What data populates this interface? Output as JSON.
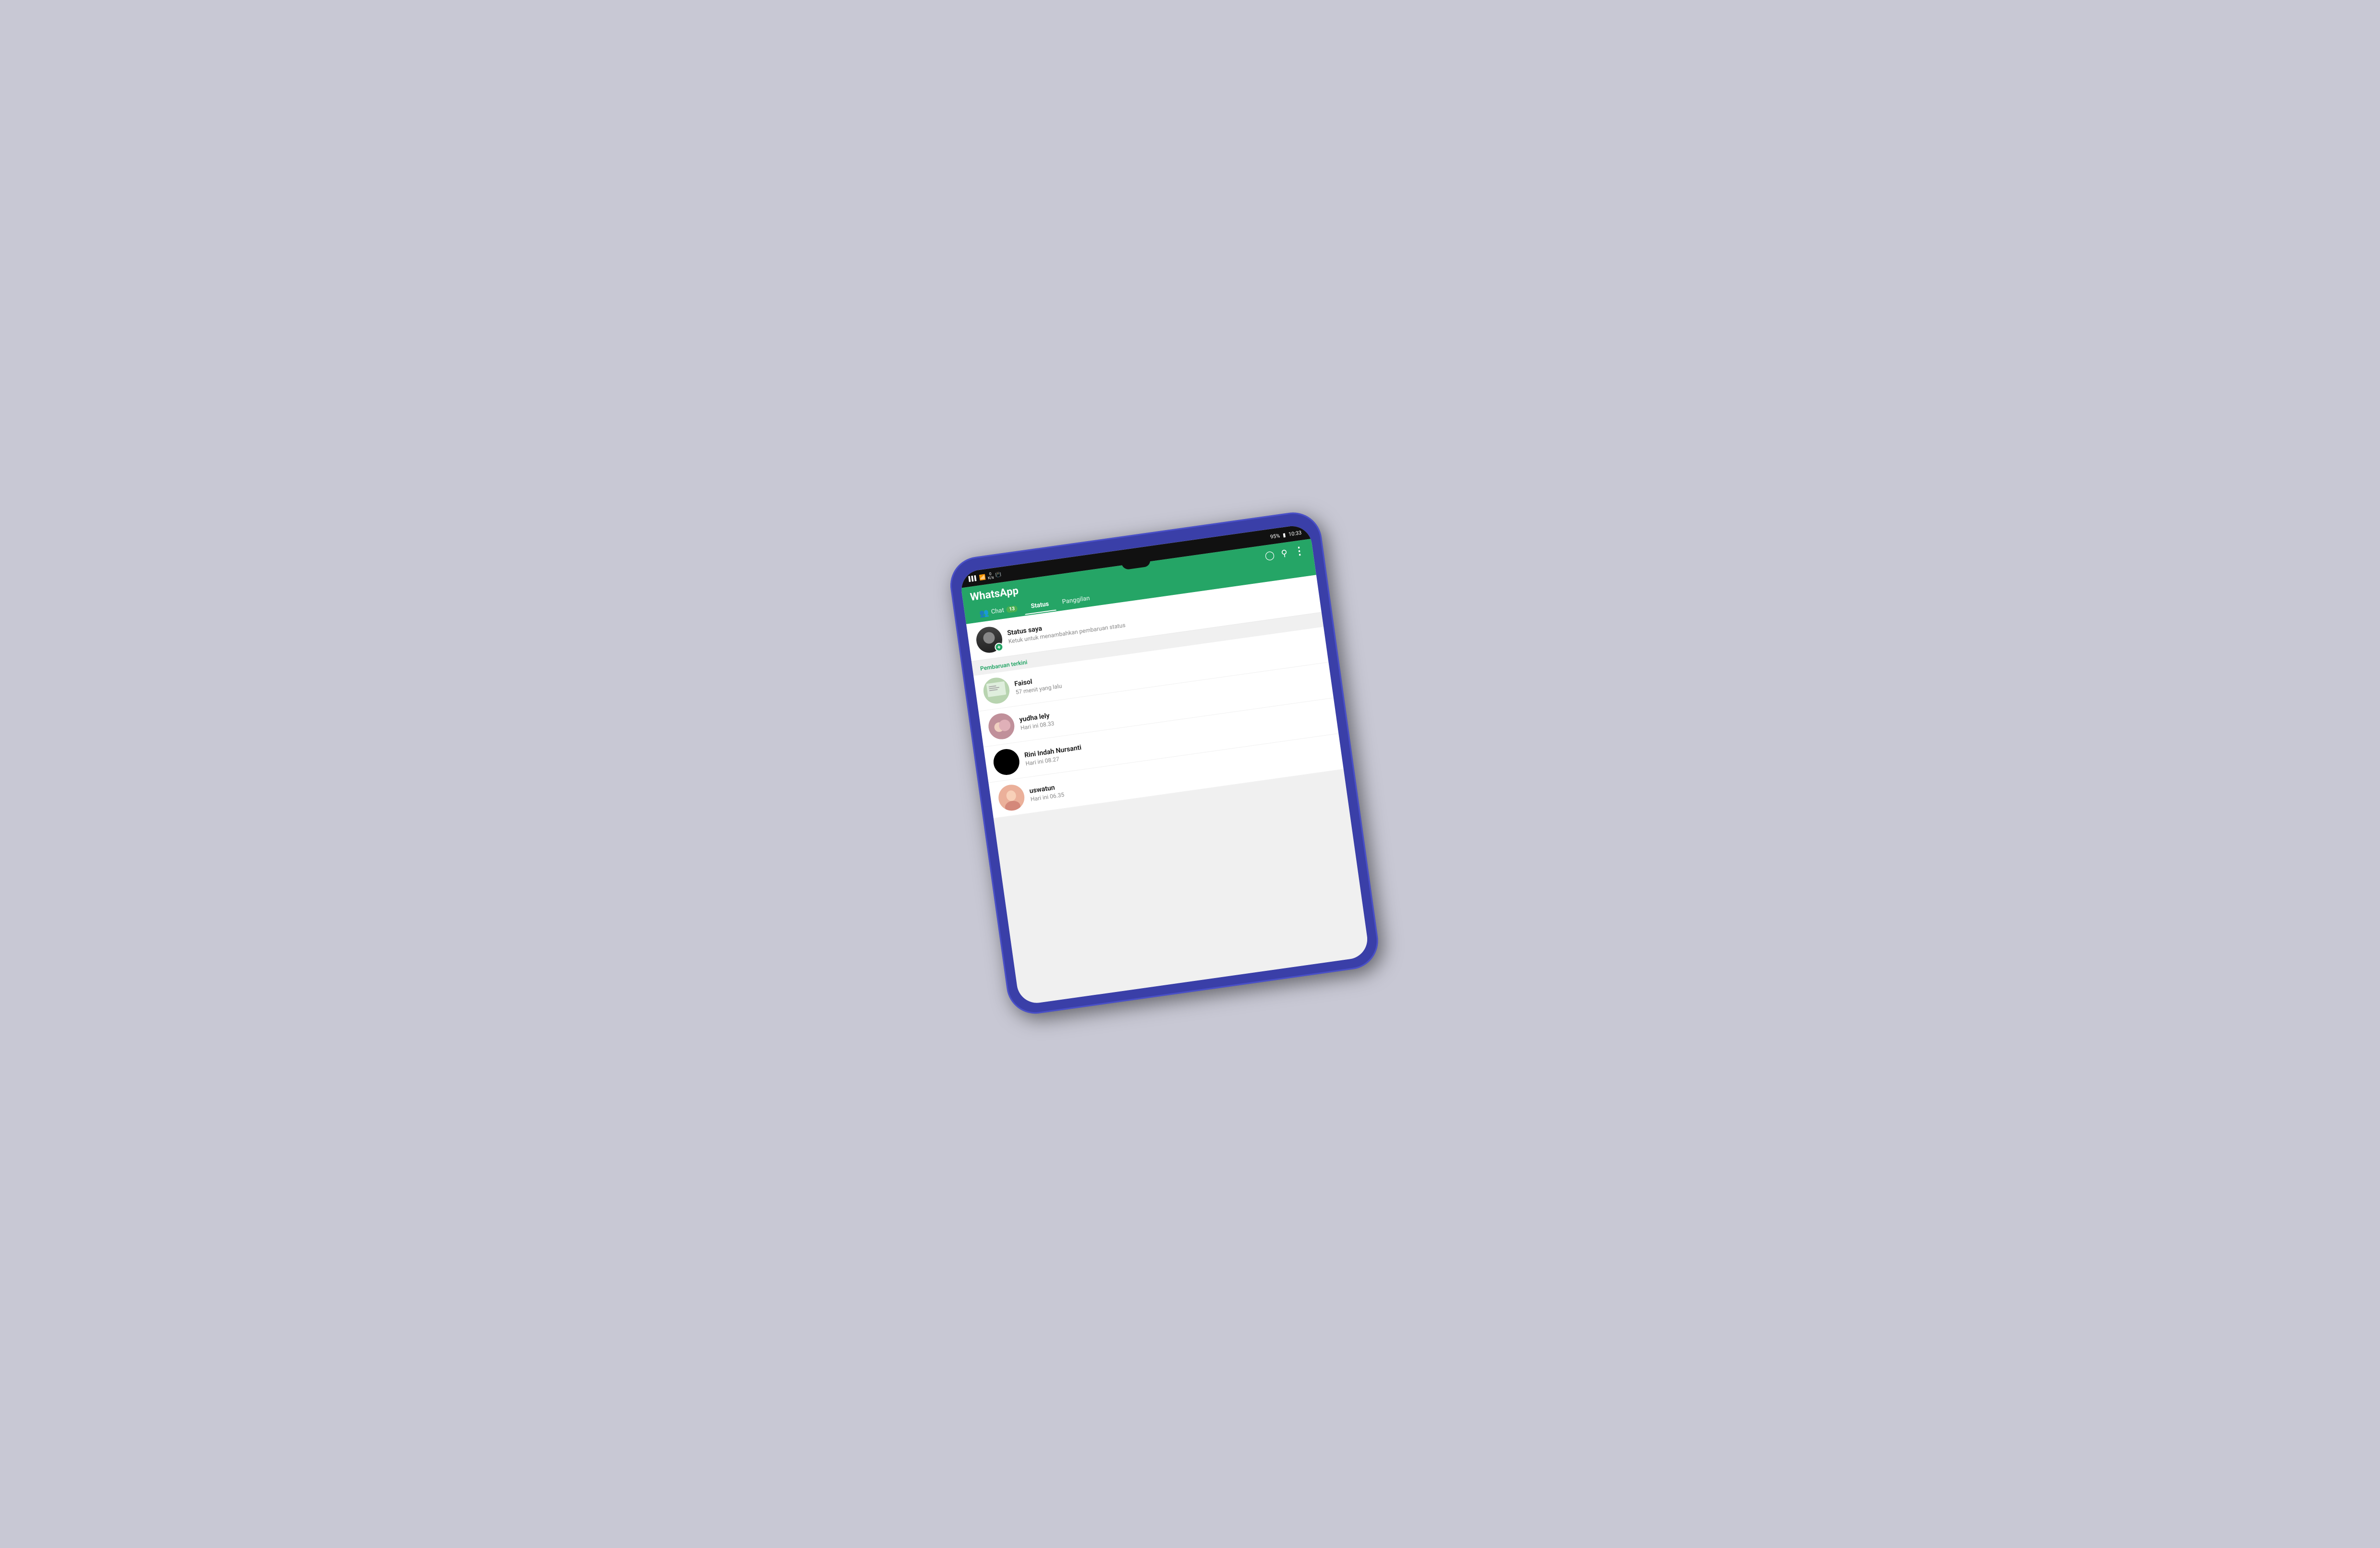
{
  "statusBar": {
    "signal": "▌▌▌",
    "wifi": "WiFi",
    "dataLabel": "0\nK/s",
    "vibrate": "📳",
    "battery": "95%",
    "batteryIcon": "🔋",
    "time": "10:33"
  },
  "header": {
    "title": "WhatsApp",
    "cameraIcon": "📷",
    "searchIcon": "🔍",
    "menuIcon": "⋮"
  },
  "tabs": [
    {
      "id": "chat",
      "label": "Chat",
      "badge": "13",
      "active": false
    },
    {
      "id": "status",
      "label": "Status",
      "active": true
    },
    {
      "id": "panggilan",
      "label": "Panggilan",
      "active": false
    }
  ],
  "myStatus": {
    "name": "Status saya",
    "subtitle": "Ketuk untuk menambahkan pembaruan status"
  },
  "sectionLabel": "Pembaruan terkini",
  "statusItems": [
    {
      "id": "faisol",
      "name": "Faisol",
      "time": "57 menit yang lalu"
    },
    {
      "id": "yudha-lely",
      "name": "yudha lely",
      "time": "Hari ini 08.33"
    },
    {
      "id": "rini",
      "name": "Rini Indah Nursanti",
      "time": "Hari ini 08.27"
    },
    {
      "id": "uswatun",
      "name": "uswatun",
      "time": "Hari ini 06.35"
    }
  ]
}
